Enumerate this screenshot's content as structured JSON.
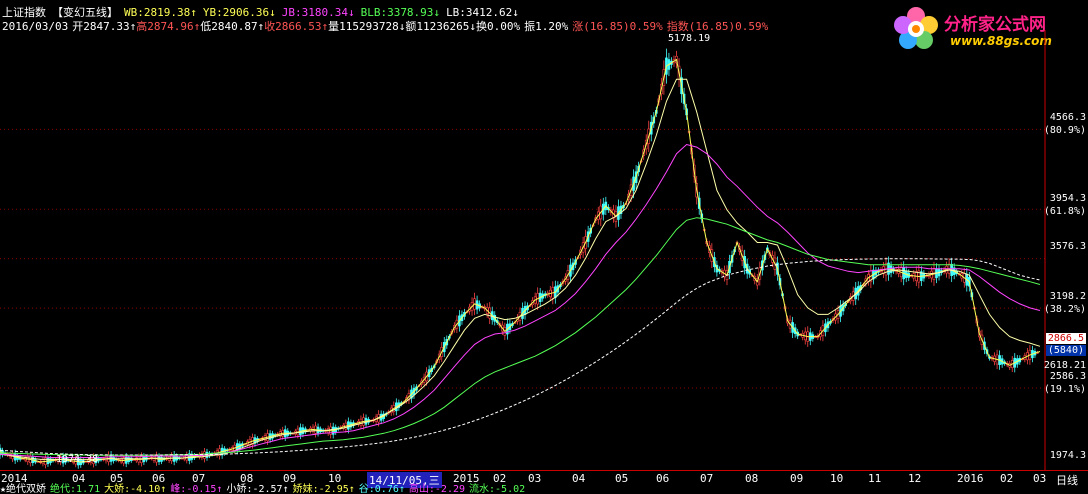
{
  "header": {
    "index_name": "上证指数",
    "formula_name": "【变幻五线】",
    "wb": "WB:2819.38↑",
    "yb": "YB:2906.36↓",
    "jb": "JB:3180.34↓",
    "blb": "BLB:3378.93↓",
    "lb": "LB:3412.62↓",
    "date": "2016/03/03",
    "open": "开2847.33↑",
    "high": "高2874.96↑",
    "low": "低2840.87↑",
    "close": "收2866.53↑",
    "volume": "量115293728↓",
    "amount": "额11236265↓",
    "turnover": "换0.00%",
    "amplitude": "振1.20%",
    "change": "涨(16.85)0.59%",
    "index_change": "指数(16.85)0.59%"
  },
  "logo": {
    "title": "分析家公式网",
    "url": "www.88gs.com"
  },
  "price_axis": {
    "labels": [
      "4566.3",
      "(80.9%)",
      "3954.3",
      "(61.8%)",
      "3576.3",
      "3198.2",
      "(38.2%)",
      "2586.3",
      "(19.1%)",
      "1974.3"
    ],
    "current_price": "2866.5",
    "current_volume": "(5840)",
    "cursor_price": "2618.21"
  },
  "annotations": {
    "peak": "5178.19",
    "low": "1974.38"
  },
  "x_axis": {
    "labels": [
      "2014",
      "04",
      "05",
      "06",
      "07",
      "08",
      "09",
      "10",
      "14/11/05,三",
      "2015",
      "02",
      "03",
      "04",
      "05",
      "06",
      "07",
      "08",
      "09",
      "10",
      "11",
      "12",
      "2016",
      "02",
      "03"
    ],
    "period": "日线"
  },
  "indicator_bar": {
    "name": "★绝代双娇",
    "items": [
      "绝代:1.71",
      "大娇:-4.10↑",
      "峰:-0.15↑",
      "小娇:-2.57↑",
      "娇妹:-2.95↑",
      "谷:0.76↑",
      "高山:-2.29",
      "流水:-5.02"
    ]
  },
  "chart_data": {
    "type": "line",
    "title": "上证指数",
    "ylabel": "",
    "xlabel": "",
    "ylim": [
      1974.3,
      5250
    ],
    "x": [
      0,
      10,
      20,
      30,
      40,
      50,
      60,
      70,
      80,
      90,
      100,
      110,
      120,
      130,
      140,
      150,
      160,
      170,
      180,
      190,
      200,
      210,
      220,
      230,
      240,
      250,
      260,
      270,
      280,
      290,
      300,
      310,
      320,
      330,
      340,
      350,
      360,
      370,
      380,
      390,
      400,
      410,
      420,
      430,
      440,
      450,
      460,
      470,
      480,
      490,
      500,
      510,
      520,
      530,
      540,
      550,
      560,
      570,
      580,
      590,
      600,
      610,
      620,
      630,
      640,
      650,
      660,
      670,
      680,
      690,
      700,
      710,
      720,
      730,
      740,
      750,
      760,
      770,
      780,
      790,
      800,
      810,
      820,
      830,
      840,
      850,
      860,
      870,
      880,
      890,
      900,
      910,
      920,
      930,
      940,
      950,
      960,
      970,
      980,
      990,
      1000,
      1010,
      1020,
      1030
    ],
    "series": [
      {
        "name": "WB",
        "color": "#ffff55",
        "values": [
          2100,
          2070,
          2050,
          2040,
          2020,
          2030,
          2040,
          2030,
          2020,
          2030,
          2040,
          2050,
          2030,
          2040,
          2040,
          2050,
          2040,
          2050,
          2050,
          2060,
          2070,
          2080,
          2100,
          2120,
          2150,
          2180,
          2200,
          2220,
          2240,
          2240,
          2260,
          2270,
          2260,
          2260,
          2290,
          2310,
          2330,
          2340,
          2370,
          2430,
          2480,
          2560,
          2650,
          2750,
          2900,
          3050,
          3150,
          3230,
          3200,
          3120,
          3020,
          3090,
          3180,
          3260,
          3300,
          3320,
          3420,
          3550,
          3700,
          3880,
          3980,
          3900,
          4000,
          4200,
          4450,
          4700,
          5050,
          5100,
          4700,
          4100,
          3700,
          3500,
          3450,
          3700,
          3500,
          3400,
          3650,
          3500,
          3100,
          3000,
          2980,
          2980,
          3070,
          3150,
          3250,
          3330,
          3430,
          3480,
          3500,
          3480,
          3450,
          3440,
          3450,
          3470,
          3500,
          3460,
          3400,
          3000,
          2820,
          2800,
          2760,
          2800,
          2840,
          2866
        ]
      },
      {
        "name": "YB",
        "color": "#ffffaa",
        "values": [
          2080,
          2070,
          2060,
          2050,
          2040,
          2040,
          2040,
          2040,
          2040,
          2040,
          2040,
          2045,
          2045,
          2045,
          2045,
          2050,
          2050,
          2050,
          2050,
          2055,
          2060,
          2070,
          2080,
          2100,
          2130,
          2160,
          2190,
          2210,
          2230,
          2240,
          2250,
          2260,
          2260,
          2270,
          2280,
          2300,
          2320,
          2340,
          2380,
          2420,
          2470,
          2530,
          2600,
          2680,
          2790,
          2910,
          3030,
          3120,
          3150,
          3130,
          3110,
          3120,
          3150,
          3190,
          3230,
          3280,
          3350,
          3450,
          3580,
          3730,
          3860,
          3900,
          3960,
          4100,
          4300,
          4520,
          4780,
          4950,
          4950,
          4700,
          4400,
          4100,
          3950,
          3850,
          3780,
          3700,
          3700,
          3680,
          3500,
          3300,
          3200,
          3150,
          3150,
          3200,
          3260,
          3320,
          3400,
          3450,
          3480,
          3490,
          3480,
          3470,
          3460,
          3470,
          3490,
          3480,
          3450,
          3300,
          3150,
          3050,
          2980,
          2950,
          2930,
          2906
        ]
      },
      {
        "name": "JB",
        "color": "#ff44ff",
        "values": [
          2080,
          2075,
          2070,
          2065,
          2060,
          2055,
          2055,
          2055,
          2055,
          2055,
          2055,
          2060,
          2060,
          2060,
          2060,
          2065,
          2065,
          2065,
          2065,
          2070,
          2070,
          2080,
          2090,
          2100,
          2120,
          2140,
          2160,
          2180,
          2200,
          2210,
          2220,
          2230,
          2240,
          2245,
          2250,
          2260,
          2280,
          2300,
          2320,
          2350,
          2390,
          2440,
          2500,
          2570,
          2660,
          2750,
          2840,
          2920,
          2970,
          3000,
          3010,
          3030,
          3060,
          3100,
          3140,
          3180,
          3240,
          3310,
          3400,
          3500,
          3610,
          3700,
          3780,
          3880,
          3990,
          4110,
          4240,
          4380,
          4450,
          4430,
          4380,
          4300,
          4200,
          4130,
          4050,
          3970,
          3900,
          3850,
          3780,
          3700,
          3620,
          3560,
          3520,
          3500,
          3480,
          3470,
          3480,
          3490,
          3500,
          3510,
          3510,
          3510,
          3500,
          3500,
          3500,
          3500,
          3490,
          3440,
          3380,
          3320,
          3270,
          3230,
          3200,
          3180
        ]
      },
      {
        "name": "BLB",
        "color": "#55ff55",
        "values": [
          2090,
          2088,
          2085,
          2082,
          2080,
          2078,
          2076,
          2075,
          2074,
          2073,
          2072,
          2072,
          2072,
          2072,
          2072,
          2073,
          2074,
          2075,
          2076,
          2078,
          2080,
          2085,
          2090,
          2095,
          2102,
          2110,
          2120,
          2130,
          2140,
          2150,
          2160,
          2170,
          2180,
          2185,
          2190,
          2200,
          2210,
          2225,
          2240,
          2260,
          2285,
          2315,
          2350,
          2390,
          2440,
          2500,
          2560,
          2620,
          2670,
          2710,
          2740,
          2770,
          2800,
          2830,
          2870,
          2910,
          2960,
          3010,
          3070,
          3130,
          3200,
          3270,
          3340,
          3420,
          3510,
          3600,
          3700,
          3800,
          3870,
          3890,
          3880,
          3860,
          3840,
          3810,
          3780,
          3750,
          3720,
          3700,
          3670,
          3640,
          3610,
          3590,
          3570,
          3560,
          3550,
          3540,
          3530,
          3530,
          3530,
          3530,
          3530,
          3530,
          3530,
          3530,
          3530,
          3525,
          3515,
          3500,
          3480,
          3460,
          3440,
          3420,
          3400,
          3379
        ]
      },
      {
        "name": "LB",
        "color": "#ffffff",
        "values": [
          2110,
          2105,
          2100,
          2095,
          2090,
          2085,
          2082,
          2080,
          2078,
          2076,
          2075,
          2074,
          2074,
          2074,
          2074,
          2074,
          2074,
          2075,
          2075,
          2076,
          2077,
          2078,
          2080,
          2082,
          2085,
          2088,
          2092,
          2096,
          2100,
          2105,
          2110,
          2116,
          2122,
          2128,
          2135,
          2142,
          2150,
          2160,
          2170,
          2182,
          2195,
          2210,
          2226,
          2244,
          2264,
          2286,
          2310,
          2336,
          2364,
          2394,
          2425,
          2458,
          2492,
          2528,
          2566,
          2606,
          2648,
          2692,
          2738,
          2786,
          2836,
          2888,
          2942,
          2998,
          3056,
          3116,
          3178,
          3242,
          3300,
          3350,
          3390,
          3420,
          3450,
          3470,
          3490,
          3505,
          3520,
          3530,
          3540,
          3548,
          3555,
          3560,
          3565,
          3568,
          3570,
          3572,
          3574,
          3575,
          3576,
          3576,
          3576,
          3576,
          3575,
          3574,
          3573,
          3572,
          3570,
          3560,
          3540,
          3510,
          3480,
          3450,
          3430,
          3413
        ]
      }
    ]
  }
}
